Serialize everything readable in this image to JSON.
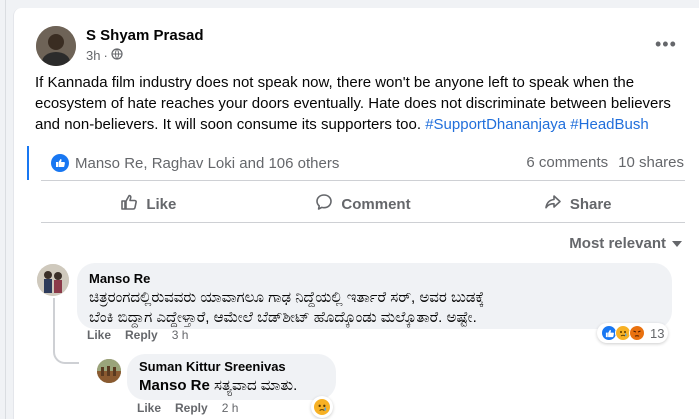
{
  "post": {
    "author": "S Shyam Prasad",
    "time": "3h",
    "text": "If Kannada film industry does not speak now, there won't be anyone left to speak when the ecosystem of hate reaches your doors eventually. Hate does not discriminate between believers and non-believers. It will soon consume its supporters too.",
    "hashtags": "#SupportDhananjaya #HeadBush"
  },
  "stats": {
    "reacted_by": "Manso Re, Raghav Loki and 106 others",
    "comments": "6 comments",
    "shares": "10 shares"
  },
  "actions": {
    "like": "Like",
    "comment": "Comment",
    "share": "Share"
  },
  "sort_label": "Most relevant",
  "comments": [
    {
      "author": "Manso Re",
      "text_line1": "ಚಿತ್ರರಂಗದಲ್ಲಿರುವವರು ಯಾವಾಗಲೂ ಗಾಢ ನಿದ್ದೆಯಲ್ಲಿ ಇರ್ತಾರೆ ಸರ್, ಅವರ ಬುಡಕ್ಕೆ",
      "text_line2": "ಬೆಂಕಿ ಬಿದ್ದಾಗ ಎದ್ದೇಳ್ತಾರೆ, ಆಮೇಲೆ ಬೆಡ್‌ಶೀಟ್ ಹೊದ್ಕೊಂಡು ಮಲ್ಕೊತಾರೆ. ಅಷ್ಟೇ.",
      "like": "Like",
      "reply": "Reply",
      "time": "3 h",
      "reaction_count": "13"
    },
    {
      "author": "Suman Kittur Sreenivas",
      "mention": "Manso Re",
      "text": "ಸತ್ಯವಾದ ಮಾತು.",
      "like": "Like",
      "reply": "Reply",
      "time": "2 h"
    }
  ],
  "colors": {
    "accent": "#1877f2",
    "hashtag": "#216fdb",
    "secondary_text": "#65676b"
  }
}
